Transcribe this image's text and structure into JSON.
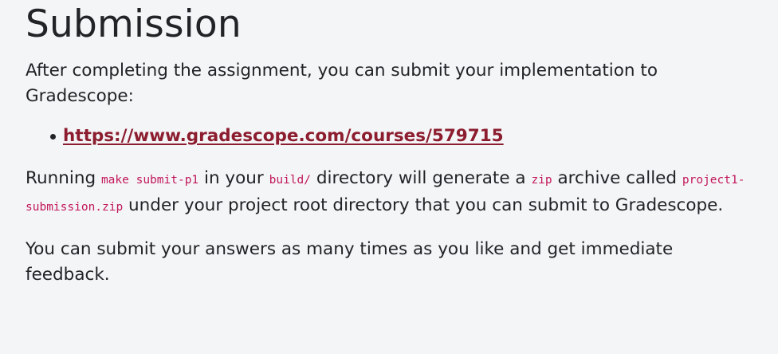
{
  "section": {
    "title": "Submission",
    "intro": "After completing the assignment, you can submit your implementation to Gradescope:",
    "links": [
      {
        "text": "https://www.gradescope.com/courses/579715"
      }
    ],
    "para2": {
      "t1": "Running ",
      "code1": "make submit-p1",
      "t2": " in your ",
      "code2": "build/",
      "t3": " directory will generate a ",
      "code3": "zip",
      "t4": " archive called ",
      "code4": "project1-submission.zip",
      "t5": " under your project root directory that you can submit to Gradescope."
    },
    "para3": "You can submit your answers as many times as you like and get immediate feedback."
  },
  "colors": {
    "background": "#f4f5f7",
    "text": "#222326",
    "link": "#8c1d2f",
    "code": "#c2185b"
  }
}
